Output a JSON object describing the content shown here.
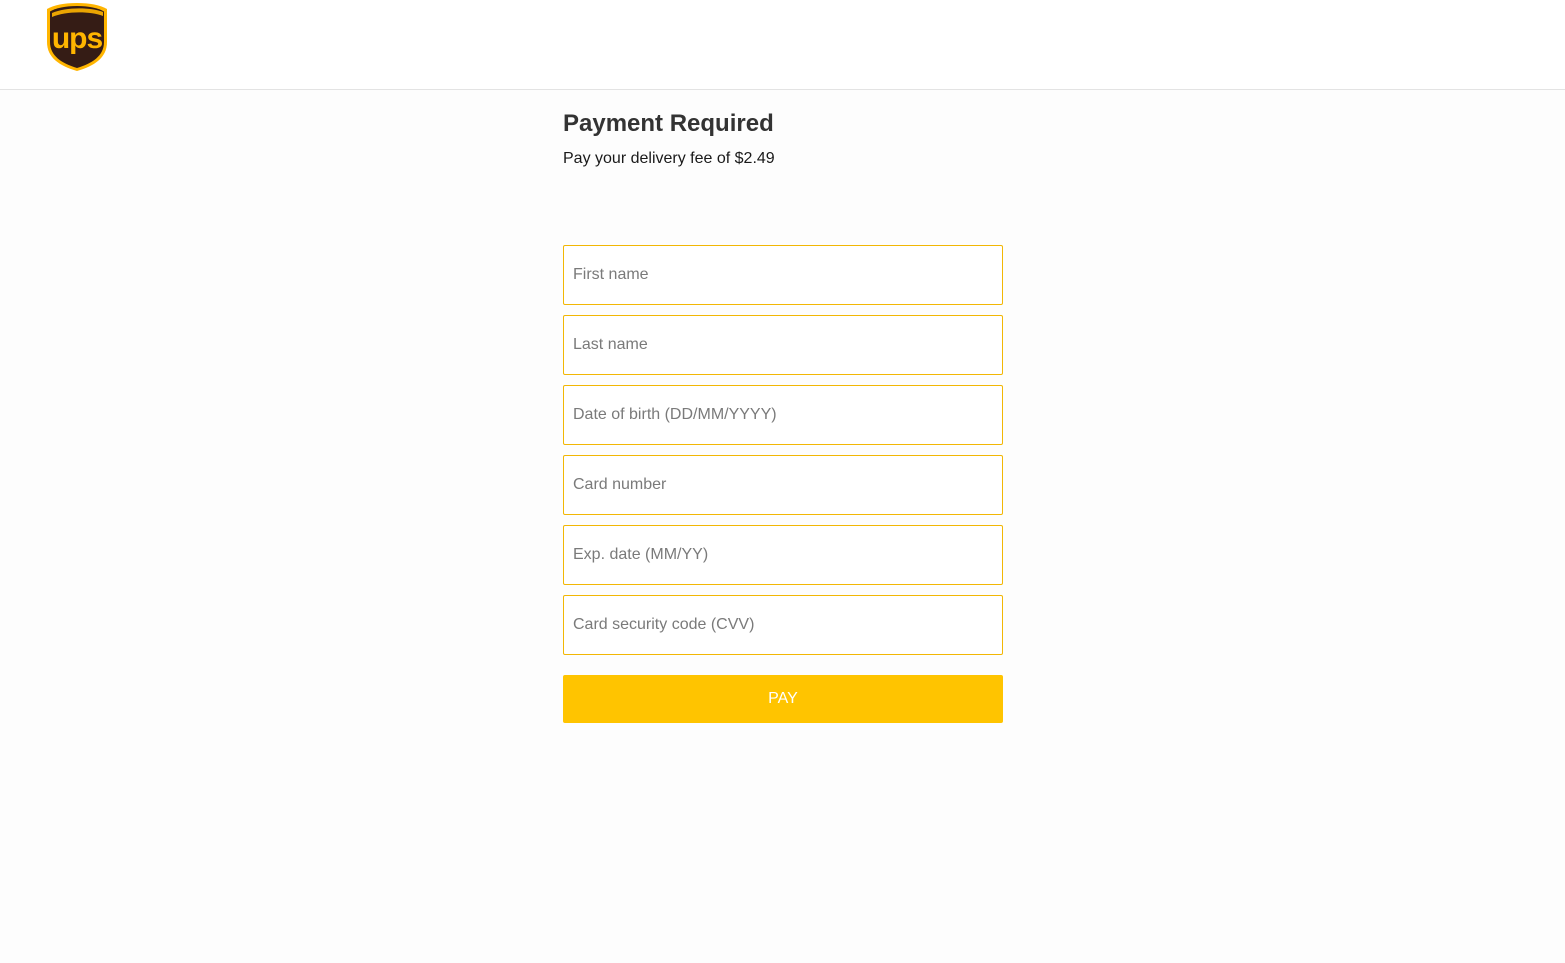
{
  "brand": {
    "logo_text": "ups",
    "logo_icon": "ups-shield-logo",
    "colors": {
      "shield_brown": "#351c15",
      "shield_gold": "#ffb500",
      "accent": "#ffc400",
      "field_border": "#f2b705"
    }
  },
  "main": {
    "title": "Payment Required",
    "subtitle": "Pay your delivery fee of $2.49"
  },
  "form": {
    "fields": [
      {
        "placeholder": "First name",
        "value": ""
      },
      {
        "placeholder": "Last name",
        "value": ""
      },
      {
        "placeholder": "Date of birth (DD/MM/YYYY)",
        "value": ""
      },
      {
        "placeholder": "Card number",
        "value": ""
      },
      {
        "placeholder": "Exp. date (MM/YY)",
        "value": ""
      },
      {
        "placeholder": "Card security code (CVV)",
        "value": ""
      }
    ],
    "submit_label": "PAY"
  }
}
